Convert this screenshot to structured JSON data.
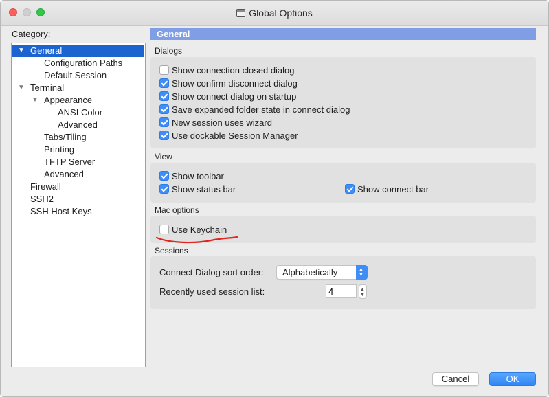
{
  "window": {
    "title": "Global Options"
  },
  "sidebar": {
    "label": "Category:",
    "items": [
      {
        "label": "General",
        "expanded": true,
        "selected": true
      },
      {
        "label": "Configuration Paths"
      },
      {
        "label": "Default Session"
      },
      {
        "label": "Terminal",
        "expanded": true
      },
      {
        "label": "Appearance",
        "expanded": true
      },
      {
        "label": "ANSI Color"
      },
      {
        "label": "Advanced"
      },
      {
        "label": "Tabs/Tiling"
      },
      {
        "label": "Printing"
      },
      {
        "label": "TFTP Server"
      },
      {
        "label": "Advanced"
      },
      {
        "label": "Firewall"
      },
      {
        "label": "SSH2"
      },
      {
        "label": "SSH Host Keys"
      }
    ]
  },
  "panel": {
    "header": "General"
  },
  "dialogs": {
    "label": "Dialogs",
    "options": [
      {
        "label": "Show connection closed dialog",
        "checked": false
      },
      {
        "label": "Show confirm disconnect dialog",
        "checked": true
      },
      {
        "label": "Show connect dialog on startup",
        "checked": true
      },
      {
        "label": "Save expanded folder state in connect dialog",
        "checked": true
      },
      {
        "label": "New session uses wizard",
        "checked": true
      },
      {
        "label": "Use dockable Session Manager",
        "checked": true
      }
    ]
  },
  "view": {
    "label": "View",
    "options": [
      {
        "label": "Show toolbar",
        "checked": true
      },
      {
        "label": "Show status bar",
        "checked": true
      },
      {
        "label": "Show connect bar",
        "checked": true
      }
    ]
  },
  "mac_options": {
    "label": "Mac options",
    "options": [
      {
        "label": "Use Keychain",
        "checked": false
      }
    ]
  },
  "sessions": {
    "label": "Sessions",
    "sort_order_label": "Connect Dialog sort order:",
    "sort_order_value": "Alphabetically",
    "recent_list_label": "Recently used session list:",
    "recent_list_value": "4"
  },
  "buttons": {
    "cancel": "Cancel",
    "ok": "OK"
  },
  "colors": {
    "accent": "#3f8ef7",
    "selection": "#1c64d0",
    "header_bar": "#7f9ee4",
    "annotation": "#e0261e"
  },
  "icons": {
    "window": "window-app-icon",
    "expanded": "triangle-down-icon",
    "check": "checkmark-icon",
    "select_arrows": "up-down-chevron-icon"
  }
}
